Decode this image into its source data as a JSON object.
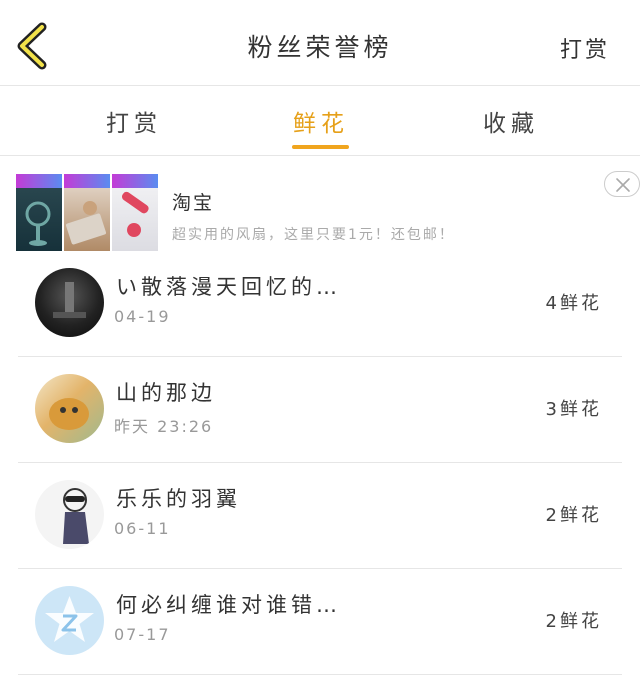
{
  "header": {
    "title": "粉丝荣誉榜",
    "action_label": "打赏"
  },
  "tabs": [
    {
      "label": "打赏",
      "active": false
    },
    {
      "label": "鲜花",
      "active": true
    },
    {
      "label": "收藏",
      "active": false
    }
  ],
  "accent_color": "#f0a51e",
  "ad": {
    "name": "淘宝",
    "description": "超实用的风扇，这里只要1元！还包邮！"
  },
  "fans": [
    {
      "name": "い散落漫天回忆的…",
      "time": "04-19",
      "count": "4鲜花"
    },
    {
      "name": "山的那边",
      "time": "昨天 23:26",
      "count": "3鲜花"
    },
    {
      "name": "乐乐的羽翼",
      "time": "06-11",
      "count": "2鲜花"
    },
    {
      "name": "何必纠缠谁对谁错…",
      "time": "07-17",
      "count": "2鲜花"
    }
  ]
}
